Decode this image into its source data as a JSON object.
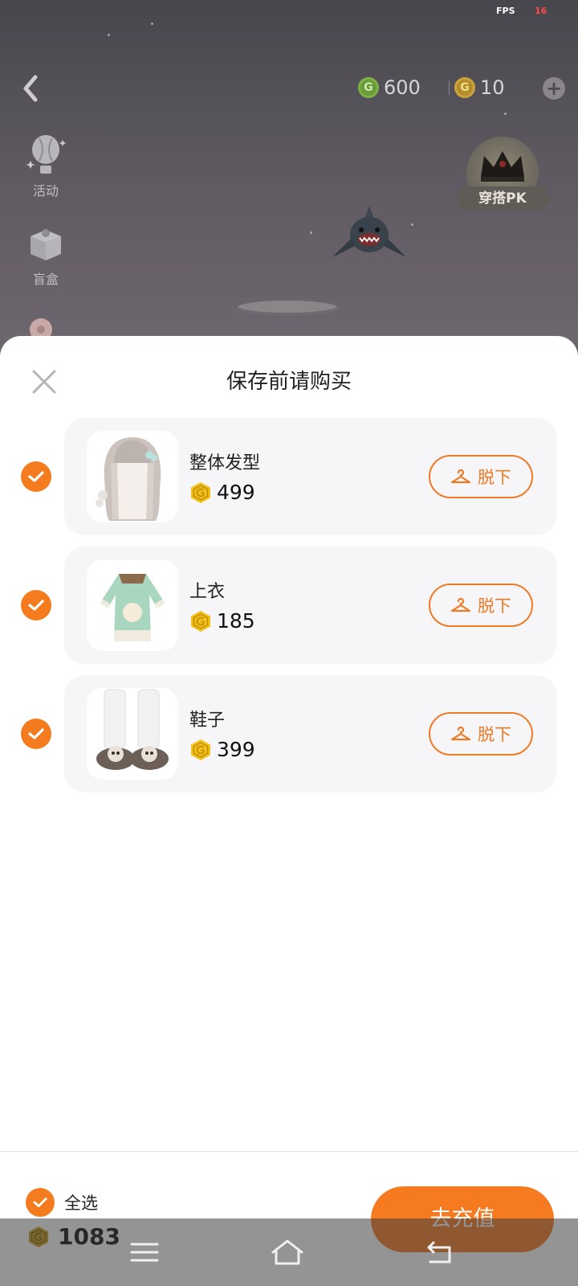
{
  "debug": {
    "fps_label": "FPS",
    "fps_value": "16"
  },
  "topbar": {
    "back_icon": "chevron-left-icon",
    "currency_green": {
      "icon": "coin-green-icon",
      "amount": "600",
      "color": "#6a9a3a"
    },
    "currency_gold": {
      "icon": "coin-gold-icon",
      "amount": "10",
      "color": "#b48d2a"
    },
    "add_icon": "plus-circle-icon"
  },
  "side_menu": [
    {
      "label": "活动",
      "icon": "balloon-icon"
    },
    {
      "label": "盲盒",
      "icon": "gift-box-icon"
    }
  ],
  "pk_badge": {
    "label": "穿搭PK",
    "icon": "crown-icon"
  },
  "sheet": {
    "title": "保存前请购买",
    "close_icon": "close-icon",
    "items": [
      {
        "name": "整体发型",
        "price": "499",
        "checked": true,
        "action": "脱下",
        "action_icon": "hanger-icon"
      },
      {
        "name": "上衣",
        "price": "185",
        "checked": true,
        "action": "脱下",
        "action_icon": "hanger-icon"
      },
      {
        "name": "鞋子",
        "price": "399",
        "checked": true,
        "action": "脱下",
        "action_icon": "hanger-icon"
      }
    ]
  },
  "footer": {
    "select_all_label": "全选",
    "balance": "1083",
    "recharge_label": "去充值"
  },
  "system_nav": {
    "menu_icon": "menu-icon",
    "home_icon": "home-icon",
    "back_icon": "back-arrow-icon"
  },
  "colors": {
    "accent": "#f47b1e",
    "card_bg": "#f6f6f9",
    "coin_gold": "#f2c21b"
  }
}
